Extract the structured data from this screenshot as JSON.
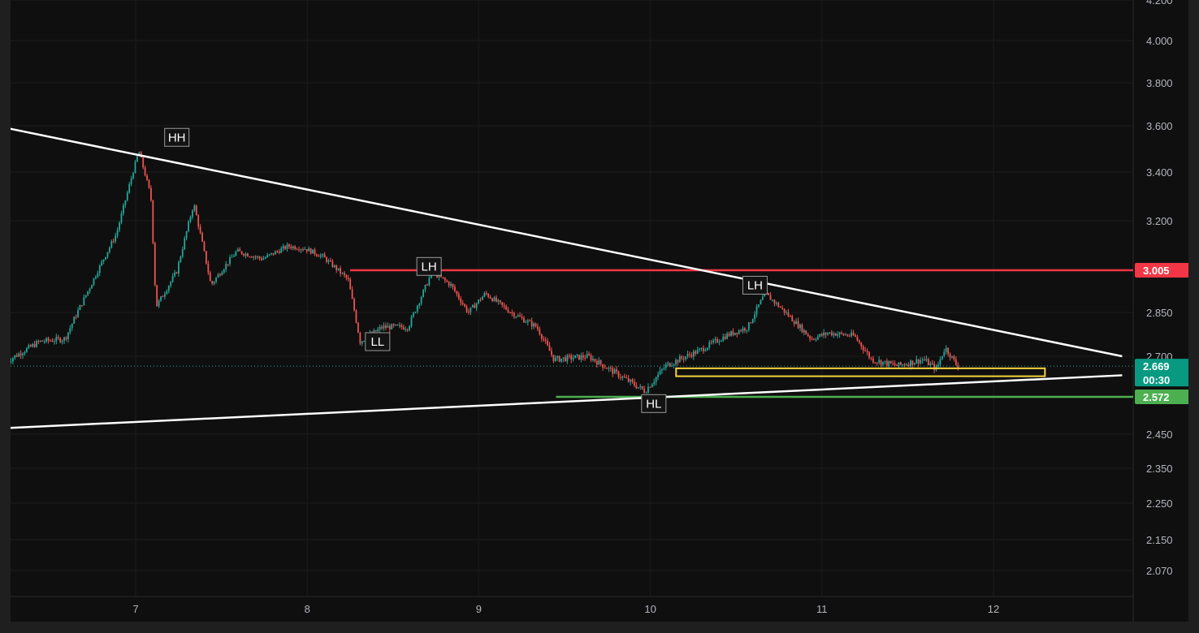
{
  "chart_data": {
    "type": "candlestick",
    "x_ticks": [
      "7",
      "8",
      "9",
      "10",
      "11",
      "12"
    ],
    "y_ticks": [
      "4.200",
      "4.000",
      "3.800",
      "3.600",
      "3.400",
      "3.200",
      "3.005",
      "2.850",
      "2.700",
      "2.572",
      "2.450",
      "2.350",
      "2.250",
      "2.150",
      "2.070"
    ],
    "price_axis_tags": [
      {
        "text": "3.005",
        "price": 3.005,
        "color": "#f23645"
      },
      {
        "text": "2.669",
        "price": 2.669,
        "color": "#089981",
        "sub": "00:30"
      },
      {
        "text": "2.572",
        "price": 2.572,
        "color": "#4caf50"
      }
    ],
    "price_path": [
      {
        "x": 6.25,
        "y": 2.68
      },
      {
        "x": 6.45,
        "y": 2.75
      },
      {
        "x": 6.6,
        "y": 2.76
      },
      {
        "x": 6.75,
        "y": 2.95
      },
      {
        "x": 6.9,
        "y": 3.15
      },
      {
        "x": 7.03,
        "y": 3.49
      },
      {
        "x": 7.1,
        "y": 3.3
      },
      {
        "x": 7.13,
        "y": 2.87
      },
      {
        "x": 7.25,
        "y": 3.0
      },
      {
        "x": 7.35,
        "y": 3.27
      },
      {
        "x": 7.45,
        "y": 2.95
      },
      {
        "x": 7.6,
        "y": 3.08
      },
      {
        "x": 7.75,
        "y": 3.05
      },
      {
        "x": 7.9,
        "y": 3.1
      },
      {
        "x": 8.0,
        "y": 3.09
      },
      {
        "x": 8.1,
        "y": 3.06
      },
      {
        "x": 8.25,
        "y": 2.97
      },
      {
        "x": 8.32,
        "y": 2.75
      },
      {
        "x": 8.45,
        "y": 2.8
      },
      {
        "x": 8.6,
        "y": 2.8
      },
      {
        "x": 8.74,
        "y": 3.0
      },
      {
        "x": 8.85,
        "y": 2.95
      },
      {
        "x": 8.95,
        "y": 2.85
      },
      {
        "x": 9.05,
        "y": 2.92
      },
      {
        "x": 9.2,
        "y": 2.85
      },
      {
        "x": 9.35,
        "y": 2.8
      },
      {
        "x": 9.45,
        "y": 2.69
      },
      {
        "x": 9.65,
        "y": 2.7
      },
      {
        "x": 9.8,
        "y": 2.65
      },
      {
        "x": 9.98,
        "y": 2.59
      },
      {
        "x": 10.1,
        "y": 2.67
      },
      {
        "x": 10.3,
        "y": 2.72
      },
      {
        "x": 10.45,
        "y": 2.77
      },
      {
        "x": 10.58,
        "y": 2.8
      },
      {
        "x": 10.68,
        "y": 2.92
      },
      {
        "x": 10.8,
        "y": 2.85
      },
      {
        "x": 10.95,
        "y": 2.76
      },
      {
        "x": 11.05,
        "y": 2.78
      },
      {
        "x": 11.2,
        "y": 2.77
      },
      {
        "x": 11.3,
        "y": 2.69
      },
      {
        "x": 11.45,
        "y": 2.67
      },
      {
        "x": 11.6,
        "y": 2.69
      },
      {
        "x": 11.68,
        "y": 2.66
      },
      {
        "x": 11.73,
        "y": 2.73
      },
      {
        "x": 11.8,
        "y": 2.669
      }
    ],
    "trendlines": [
      {
        "from": {
          "x": 6.25,
          "y": 3.59
        },
        "to": {
          "x": 12.75,
          "y": 2.7
        },
        "color": "#ffffff"
      },
      {
        "from": {
          "x": 6.25,
          "y": 2.47
        },
        "to": {
          "x": 12.75,
          "y": 2.64
        },
        "color": "#ffffff"
      }
    ],
    "horizontal_lines": [
      {
        "price": 3.005,
        "x_from": 8.25,
        "color": "#f23645"
      },
      {
        "price": 2.572,
        "x_from": 9.45,
        "color": "#4caf50"
      }
    ],
    "last_price": 2.669,
    "zone": {
      "x_from": 10.15,
      "x_to": 12.3,
      "y_top": 2.662,
      "y_bottom": 2.637,
      "color": "#f7d23c"
    },
    "annotations": [
      {
        "text": "HH",
        "x": 7.24,
        "y": 3.55
      },
      {
        "text": "LH",
        "x": 8.71,
        "y": 3.02
      },
      {
        "text": "LL",
        "x": 8.41,
        "y": 2.75
      },
      {
        "text": "LH",
        "x": 10.61,
        "y": 2.95
      },
      {
        "text": "HL",
        "x": 10.02,
        "y": 2.55
      }
    ]
  }
}
